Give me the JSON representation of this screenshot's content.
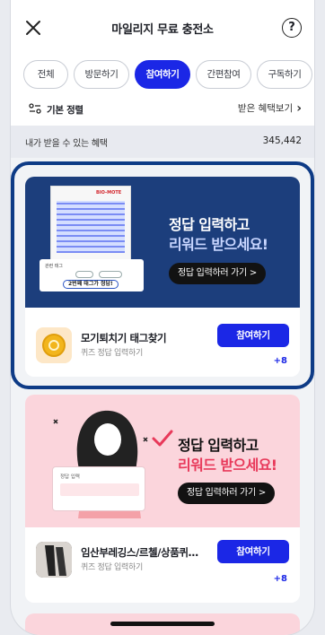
{
  "header": {
    "title": "마일리지 무료 충전소",
    "close_icon": "close-icon",
    "help_label": "?"
  },
  "tabs": [
    {
      "label": "전체",
      "active": false
    },
    {
      "label": "방문하기",
      "active": false
    },
    {
      "label": "참여하기",
      "active": true
    },
    {
      "label": "간편참여",
      "active": false
    },
    {
      "label": "구독하기",
      "active": false
    }
  ],
  "sort": {
    "label": "기본 정렬",
    "view_link": "받은 혜택보기",
    "chevron": "›"
  },
  "benefit": {
    "label": "내가 받을 수 있는 혜택",
    "value": "345,442"
  },
  "cards": [
    {
      "banner": {
        "headline": "정답 입력하고",
        "subline": "리워드 받으세요!",
        "button": "정답 입력하러 가기 >",
        "product_brand": "BIO-MOTE",
        "quiz_top": "관련 태그",
        "quiz_answer": "2번째 태그가 정답!"
      },
      "title": "모기퇴치기 태그찾기",
      "subtitle": "퀴즈 정답 입력하기",
      "button": "참여하기",
      "reward": "+8"
    },
    {
      "banner": {
        "headline": "정답 입력하고",
        "subline": "리워드 받으세요!",
        "button": "정답 입력하러 가기 >",
        "note_label": "정답 입력"
      },
      "title": "임산부레깅스/르첼/상품퀴…",
      "subtitle": "퀴즈 정답 입력하기",
      "button": "참여하기",
      "reward": "+8"
    }
  ],
  "colors": {
    "accent": "#1b27e6",
    "banner_navy": "#1c3e7c",
    "banner_pink": "#fbd5dc",
    "highlight": "#0e3b86",
    "subline_blue": "#c8d6ff",
    "subline_pink": "#e8395a"
  }
}
